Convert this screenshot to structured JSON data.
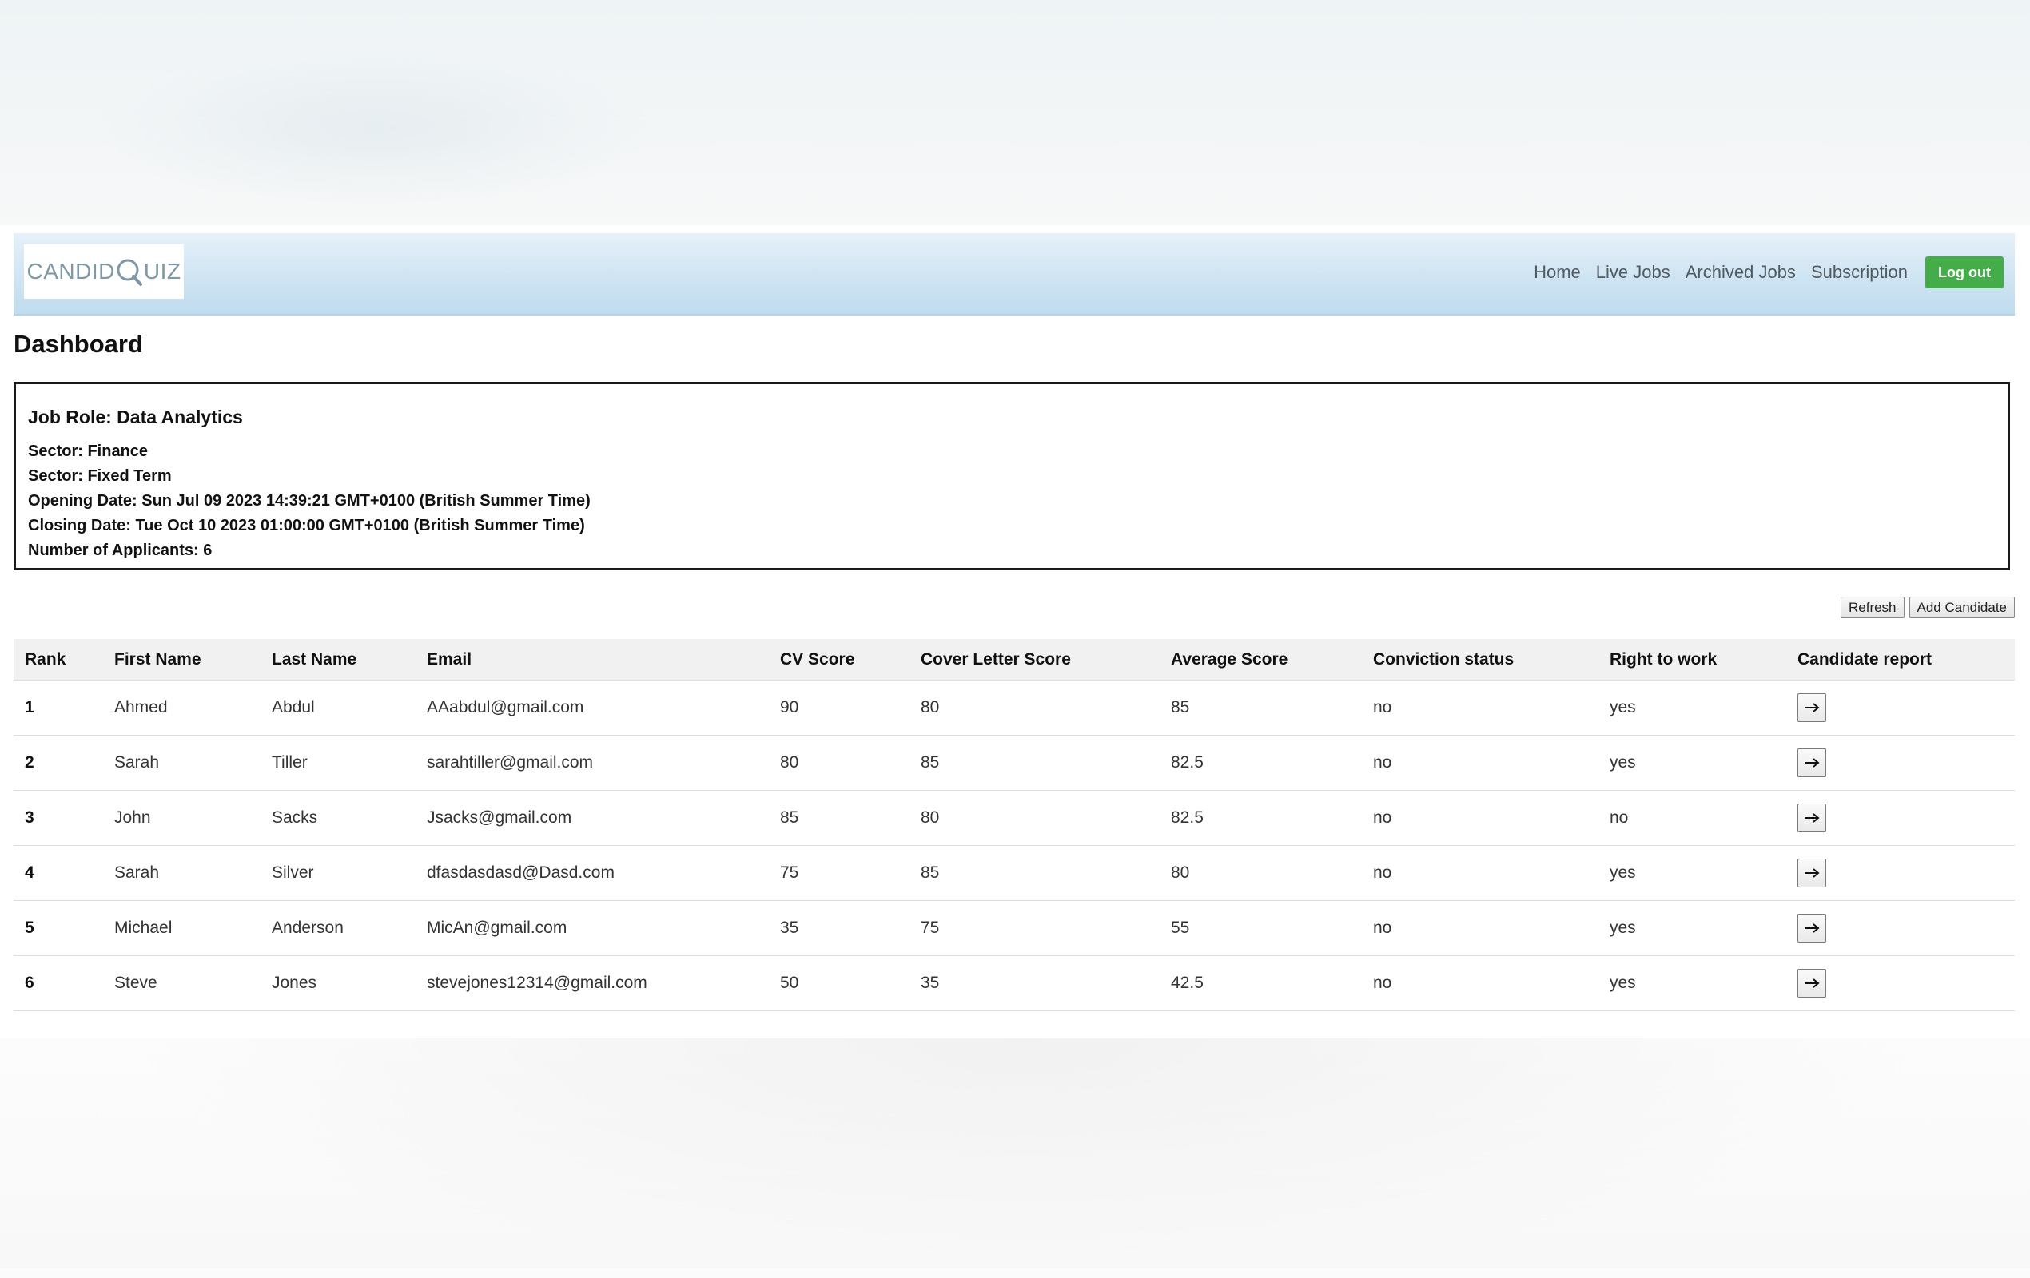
{
  "brand": {
    "logo_text_left": "CANDID",
    "logo_text_right": "UIZ",
    "logo_color": "#7e98a6"
  },
  "nav": {
    "items": [
      {
        "label": "Home"
      },
      {
        "label": "Live Jobs"
      },
      {
        "label": "Archived Jobs"
      },
      {
        "label": "Subscription"
      }
    ],
    "logout_label": "Log out",
    "logout_color": "#44ad4a"
  },
  "page": {
    "title": "Dashboard"
  },
  "job": {
    "role": "Job Role: Data Analytics",
    "sector": "Sector: Finance",
    "sector_type": "Sector: Fixed Term",
    "opening_date": "Opening Date: Sun Jul 09 2023 14:39:21 GMT+0100 (British Summer Time)",
    "closing_date": "Closing Date: Tue Oct 10 2023 01:00:00 GMT+0100 (British Summer Time)",
    "applicants": "Number of Applicants: 6"
  },
  "actions": {
    "refresh_label": "Refresh",
    "add_candidate_label": "Add Candidate"
  },
  "table": {
    "headers": [
      "Rank",
      "First Name",
      "Last Name",
      "Email",
      "CV Score",
      "Cover Letter Score",
      "Average Score",
      "Conviction status",
      "Right to work",
      "Candidate report"
    ],
    "rows": [
      {
        "rank": "1",
        "first": "Ahmed",
        "last": "Abdul",
        "email": "AAabdul@gmail.com",
        "cv": "90",
        "cover": "80",
        "avg": "85",
        "conviction": "no",
        "rtw": "yes",
        "report_icon": "arrow-right-icon"
      },
      {
        "rank": "2",
        "first": "Sarah",
        "last": "Tiller",
        "email": "sarahtiller@gmail.com",
        "cv": "80",
        "cover": "85",
        "avg": "82.5",
        "conviction": "no",
        "rtw": "yes",
        "report_icon": "arrow-right-icon"
      },
      {
        "rank": "3",
        "first": "John",
        "last": "Sacks",
        "email": "Jsacks@gmail.com",
        "cv": "85",
        "cover": "80",
        "avg": "82.5",
        "conviction": "no",
        "rtw": "no",
        "report_icon": "arrow-right-icon"
      },
      {
        "rank": "4",
        "first": "Sarah",
        "last": "Silver",
        "email": "dfasdasdasd@Dasd.com",
        "cv": "75",
        "cover": "85",
        "avg": "80",
        "conviction": "no",
        "rtw": "yes",
        "report_icon": "arrow-right-icon"
      },
      {
        "rank": "5",
        "first": "Michael",
        "last": "Anderson",
        "email": "MicAn@gmail.com",
        "cv": "35",
        "cover": "75",
        "avg": "55",
        "conviction": "no",
        "rtw": "yes",
        "report_icon": "arrow-right-icon"
      },
      {
        "rank": "6",
        "first": "Steve",
        "last": "Jones",
        "email": "stevejones12314@gmail.com",
        "cv": "50",
        "cover": "35",
        "avg": "42.5",
        "conviction": "no",
        "rtw": "yes",
        "report_icon": "arrow-right-icon"
      }
    ]
  }
}
